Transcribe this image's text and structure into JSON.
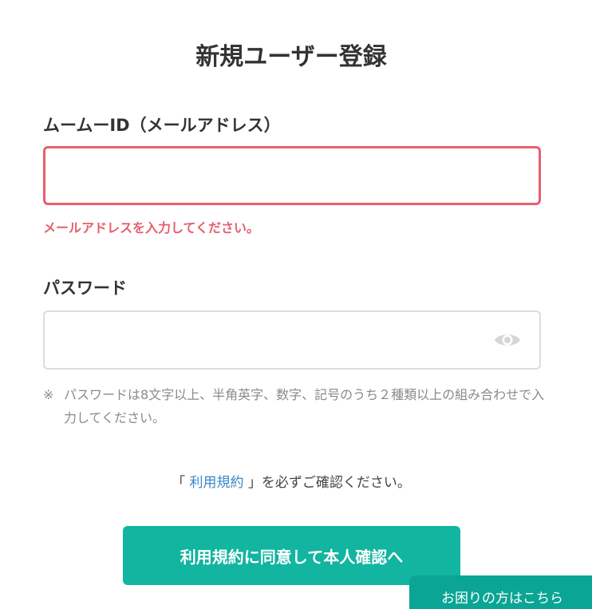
{
  "page": {
    "title": "新規ユーザー登録"
  },
  "email_field": {
    "label": "ムームーID（メールアドレス）",
    "value": "",
    "error": "メールアドレスを入力してください。"
  },
  "password_field": {
    "label": "パスワード",
    "value": "",
    "note_mark": "※",
    "note": "パスワードは8文字以上、半角英字、数字、記号のうち２種類以上の組み合わせで入力してください。"
  },
  "terms": {
    "open_bracket": "「 ",
    "link_text": "利用規約",
    "close_bracket": " 」",
    "suffix": "を必ずご確認ください。"
  },
  "submit": {
    "label": "利用規約に同意して本人確認へ"
  },
  "help_tab": {
    "label": "お困りの方はこちら"
  },
  "colors": {
    "error": "#e5606c",
    "accent": "#11b5a0",
    "link": "#3a86c8"
  }
}
